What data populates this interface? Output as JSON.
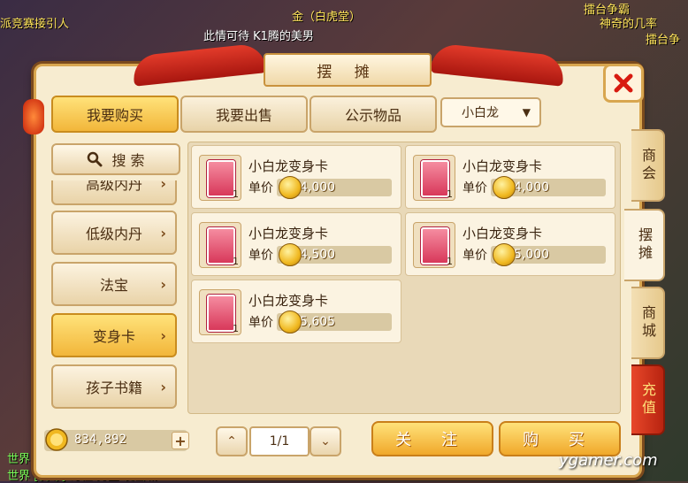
{
  "background_chat": [
    {
      "text": "派竞赛接引人",
      "color": "yellow"
    },
    {
      "text": "金（白虎堂）",
      "color": "yellow"
    },
    {
      "text": "此情可待 K1腾的美男",
      "color": "white"
    },
    {
      "text": "擂台争霸",
      "color": "yellow"
    },
    {
      "text": "神奇的几率",
      "color": "yellow"
    },
    {
      "text": "擂台争",
      "color": "yellow"
    },
    {
      "text": "世界",
      "color": "green"
    },
    {
      "text": "世界 [骑尊] 奇性  男主  发出城",
      "color": "green"
    }
  ],
  "window": {
    "title": "摆 摊",
    "close_icon": "close-x-icon"
  },
  "top_tabs": [
    {
      "label": "我要购买",
      "active": true
    },
    {
      "label": "我要出售",
      "active": false
    },
    {
      "label": "公示物品",
      "active": false
    }
  ],
  "filter_dropdown": {
    "selected": "小白龙",
    "arrow": "▼"
  },
  "search": {
    "label": "搜 索",
    "icon": "search-icon"
  },
  "categories": [
    {
      "label": "高级内丹",
      "active": false
    },
    {
      "label": "低级内丹",
      "active": false
    },
    {
      "label": "法宝",
      "active": false
    },
    {
      "label": "变身卡",
      "active": true
    },
    {
      "label": "孩子书籍",
      "active": false
    }
  ],
  "listings": [
    {
      "name": "小白龙变身卡",
      "price_label": "单价",
      "price": "4,000",
      "qty": "1"
    },
    {
      "name": "小白龙变身卡",
      "price_label": "单价",
      "price": "4,000",
      "qty": "1"
    },
    {
      "name": "小白龙变身卡",
      "price_label": "单价",
      "price": "4,500",
      "qty": "1"
    },
    {
      "name": "小白龙变身卡",
      "price_label": "单价",
      "price": "5,000",
      "qty": "1"
    },
    {
      "name": "小白龙变身卡",
      "price_label": "单价",
      "price": "5,605",
      "qty": "1"
    }
  ],
  "side_tabs": [
    {
      "label": "商会"
    },
    {
      "label": "摆摊",
      "active": true
    },
    {
      "label": "商城"
    },
    {
      "label": "充值"
    }
  ],
  "footer": {
    "money": "834,892",
    "plus": "+",
    "prev_page": "⌃",
    "page": "1/1",
    "next_page": "⌄",
    "follow_label": "关 注",
    "buy_label": "购 买"
  },
  "watermark": "ygamer.com",
  "colors": {
    "accent_gold": "#f2b63a",
    "panel_bg": "#f7ecd0",
    "border_brown": "#c9a46a",
    "close_red": "#d81a10"
  }
}
